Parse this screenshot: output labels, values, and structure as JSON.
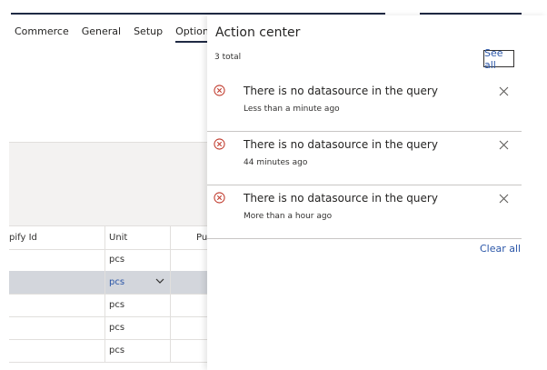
{
  "menu": {
    "items": [
      "Commerce",
      "General",
      "Setup",
      "Options"
    ],
    "active_index": 3
  },
  "grid": {
    "columns": [
      "pify Id",
      "Unit",
      "Pu"
    ],
    "rows": [
      {
        "unit": "pcs",
        "selected": false
      },
      {
        "unit": "pcs",
        "selected": true
      },
      {
        "unit": "pcs",
        "selected": false
      },
      {
        "unit": "pcs",
        "selected": false
      },
      {
        "unit": "pcs",
        "selected": false
      }
    ]
  },
  "action_center": {
    "title": "Action center",
    "total": "3 total",
    "see_all": "See all",
    "clear_all": "Clear all",
    "notifications": [
      {
        "message": "There is no datasource in the query",
        "time": "Less than a minute ago",
        "icon": "error-circle-icon"
      },
      {
        "message": "There is no datasource in the query",
        "time": "44 minutes ago",
        "icon": "error-circle-icon"
      },
      {
        "message": "There is no datasource in the query",
        "time": "More than a hour ago",
        "icon": "error-circle-icon"
      }
    ]
  },
  "colors": {
    "accent": "#2b56a8",
    "error": "#c0392b",
    "selected_row": "#d3d6dc"
  }
}
